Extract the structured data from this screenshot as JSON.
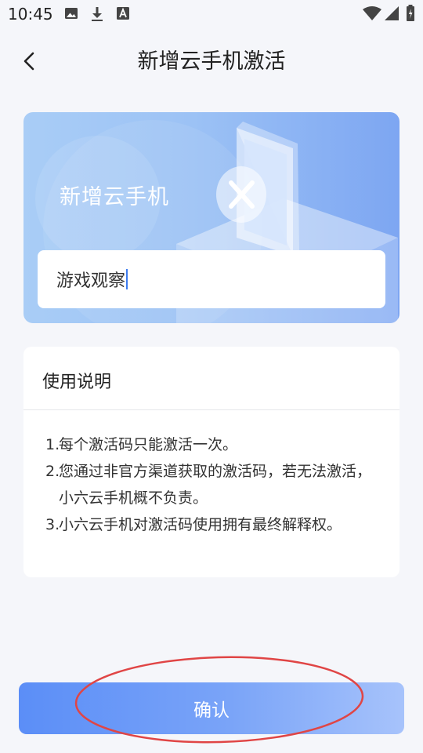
{
  "status_bar": {
    "time": "10:45"
  },
  "header": {
    "title": "新增云手机激活"
  },
  "card": {
    "title": "新增云手机",
    "input_value": "游戏观察"
  },
  "instructions": {
    "heading": "使用说明",
    "items": [
      {
        "num": "1.",
        "text": "每个激活码只能激活一次。"
      },
      {
        "num": "2.",
        "text": "您通过非官方渠道获取的激活码，若无法激活，小六云手机概不负责。"
      },
      {
        "num": "3.",
        "text": "小六云手机对激活码使用拥有最终解释权。"
      }
    ]
  },
  "confirm_label": "确认",
  "colors": {
    "accent": "#5b8ef7",
    "annotation": "#e04545"
  }
}
